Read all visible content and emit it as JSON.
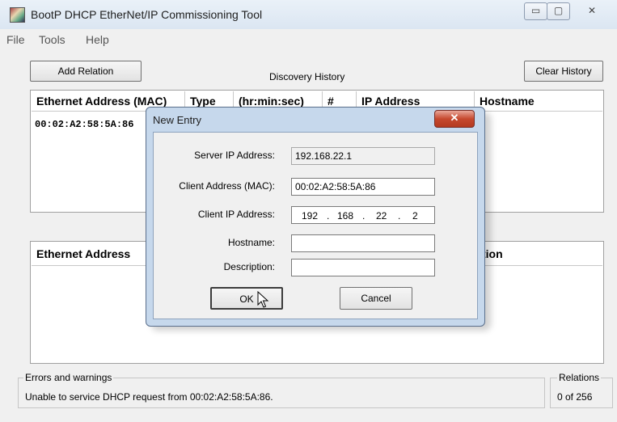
{
  "window": {
    "title": "BootP DHCP EtherNet/IP Commissioning Tool",
    "min_glyph": "▭",
    "max_glyph": "▢",
    "close_glyph": "✕"
  },
  "menu": {
    "items": [
      "File",
      "Tools",
      "Help"
    ]
  },
  "toolbar": {
    "add_relation": "Add Relation",
    "discovery_history": "Discovery History",
    "clear_history": "Clear History"
  },
  "history_table": {
    "columns": [
      "Ethernet Address (MAC)",
      "Type",
      "(hr:min:sec)",
      "#",
      "IP Address",
      "Hostname"
    ],
    "rows": [
      [
        "00:02:A2:58:5A:86",
        "",
        "",
        "",
        "",
        ""
      ]
    ]
  },
  "relation_table": {
    "columns": [
      "Ethernet Address",
      "",
      "",
      "tion"
    ]
  },
  "dialog": {
    "title": "New Entry",
    "close_glyph": "✕",
    "server_ip_label": "Server IP Address:",
    "server_ip_value": "192.168.22.1",
    "client_mac_label": "Client Address (MAC):",
    "client_mac_value": "00:02:A2:58:5A:86",
    "client_ip_label": "Client IP Address:",
    "client_ip": [
      "192",
      "168",
      "22",
      "2"
    ],
    "ip_dot": ".",
    "hostname_label": "Hostname:",
    "hostname_value": "",
    "description_label": "Description:",
    "description_value": "",
    "ok_label": "OK",
    "cancel_label": "Cancel"
  },
  "status": {
    "errors_label": "Errors and warnings",
    "errors_text": "Unable to service DHCP request from 00:02:A2:58:5A:86.",
    "relations_label": "Relations",
    "relations_text": "0 of 256"
  }
}
